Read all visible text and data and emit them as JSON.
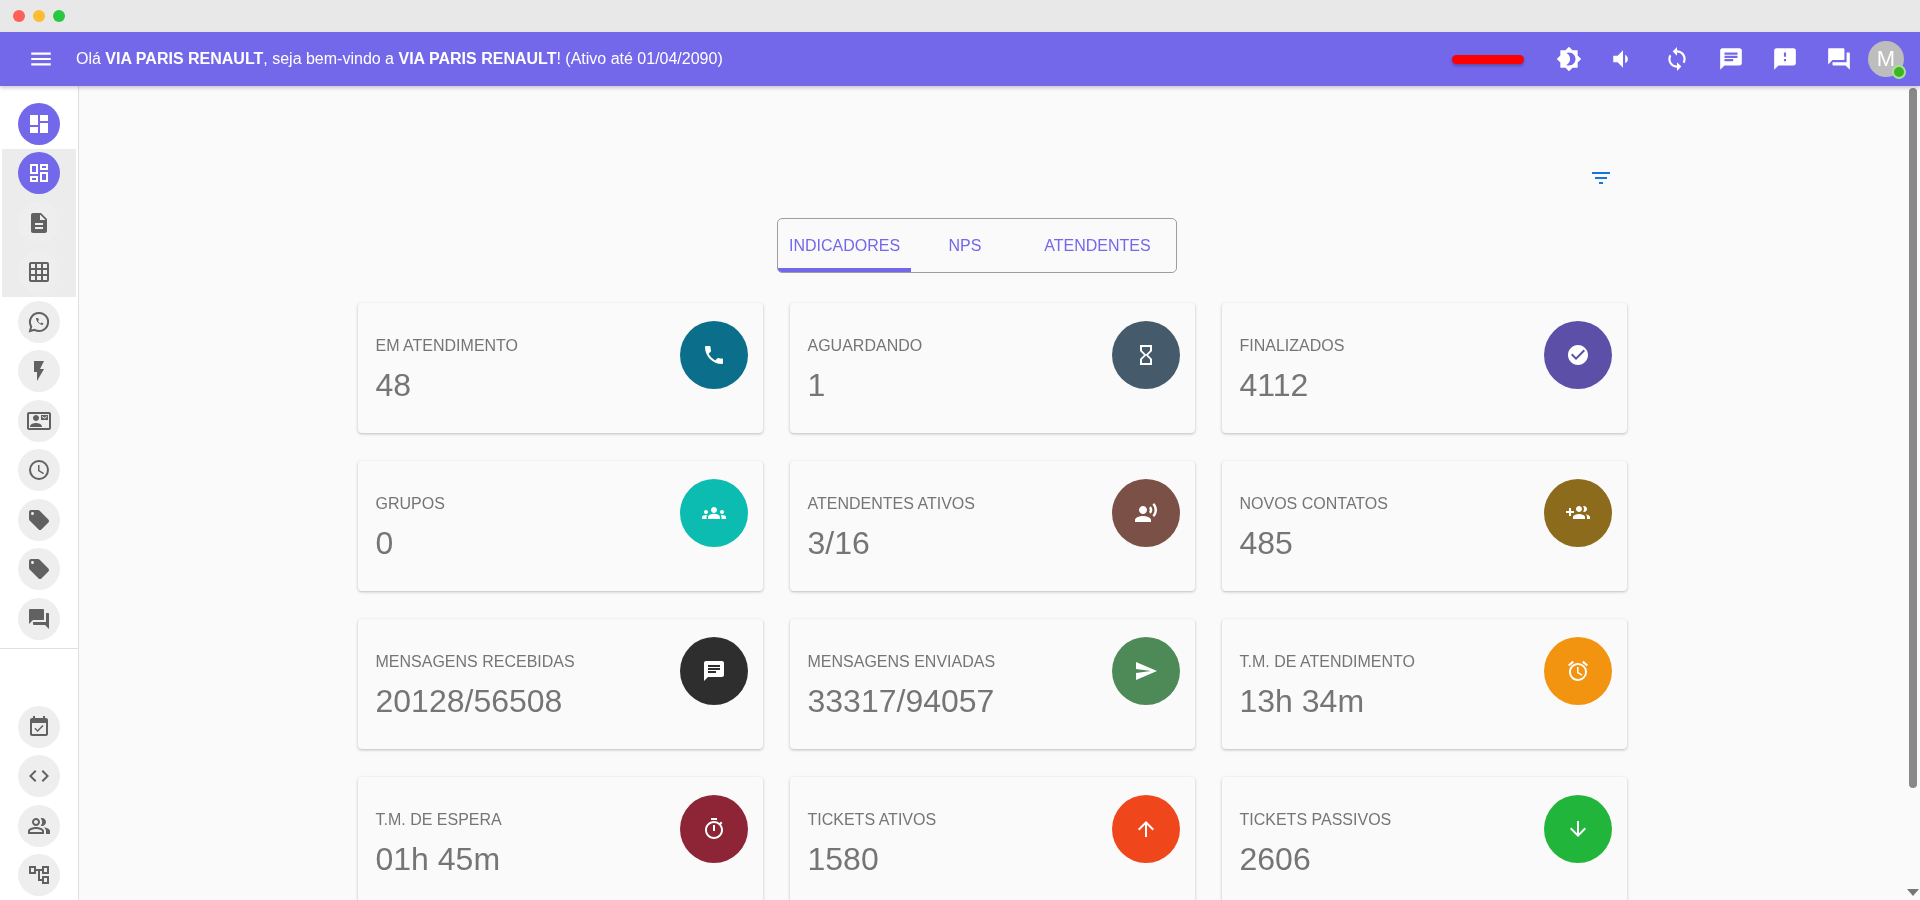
{
  "app_bar": {
    "greeting": "Olá **VIA PARIS RENAULT**, seja bem-vindo a **VIA PARIS RENAULT**! (Ativo até 01/04/2090)",
    "user": {
      "initial": "M",
      "online": true
    }
  },
  "sidebar": {
    "items": [
      {
        "selected": true,
        "expanded": true,
        "children": [
          {
            "selected": true
          },
          {
            "selected": false
          },
          {
            "selected": false
          }
        ]
      },
      {
        "selected": false
      },
      {
        "selected": false
      },
      {
        "selected": false
      },
      {
        "selected": false
      },
      {
        "selected": false
      },
      {
        "selected": false
      },
      {
        "selected": false
      }
    ],
    "bottom_items": [
      {
        "selected": false
      },
      {
        "selected": false
      },
      {
        "selected": false
      },
      {
        "selected": false
      }
    ]
  },
  "tabs": [
    {
      "label": "INDICADORES",
      "selected": true
    },
    {
      "label": "NPS",
      "selected": false
    },
    {
      "label": "ATENDENTES",
      "selected": false
    }
  ],
  "cards": [
    {
      "label": "EM ATENDIMENTO",
      "value": "48",
      "color": "#0b6e8a"
    },
    {
      "label": "AGUARDANDO",
      "value": "1",
      "color": "#455a6b"
    },
    {
      "label": "FINALIZADOS",
      "value": "4112",
      "color": "#5b4fa8"
    },
    {
      "label": "GRUPOS",
      "value": "0",
      "color": "#0cbcb0"
    },
    {
      "label": "ATENDENTES ATIVOS",
      "value": "3/16",
      "color": "#7b5147"
    },
    {
      "label": "NOVOS CONTATOS",
      "value": "485",
      "color": "#8c6c1c"
    },
    {
      "label": "MENSAGENS RECEBIDAS",
      "value": "20128/56508",
      "color": "#2e2e2e"
    },
    {
      "label": "MENSAGENS ENVIADAS",
      "value": "33317/94057",
      "color": "#4e8a57"
    },
    {
      "label": "T.M. DE ATENDIMENTO",
      "value": "13h 34m",
      "color": "#f39410"
    },
    {
      "label": "T.M. DE ESPERA",
      "value": "01h 45m",
      "color": "#8d2537"
    },
    {
      "label": "TICKETS ATIVOS",
      "value": "1580",
      "color": "#f0461c"
    },
    {
      "label": "TICKETS PASSIVOS",
      "value": "2606",
      "color": "#22b53c"
    }
  ]
}
